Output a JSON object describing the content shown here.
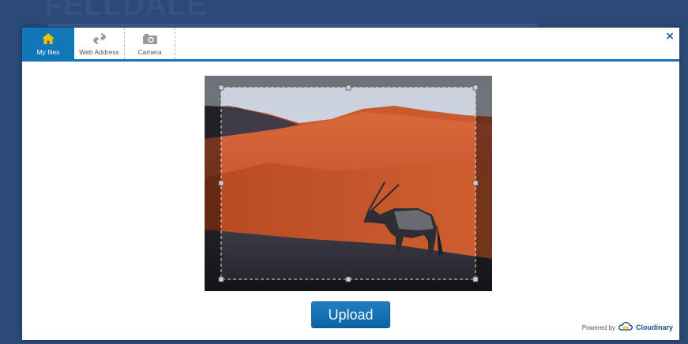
{
  "background": {
    "title": "FELLDALE"
  },
  "widget": {
    "tabs": [
      {
        "label": "My files",
        "icon": "home-icon",
        "active": true
      },
      {
        "label": "Web Address",
        "icon": "link-icon",
        "active": false
      },
      {
        "label": "Camera",
        "icon": "camera-icon",
        "active": false
      }
    ],
    "close_label": "×",
    "upload_label": "Upload",
    "powered_by": "Powered by",
    "brand": "Cloudinary"
  },
  "colors": {
    "accent": "#1277b8",
    "page_background": "#2b4a78",
    "dune": "#c8542a"
  },
  "image": {
    "subject": "oryx on red desert dunes",
    "crop_selection": "active"
  }
}
